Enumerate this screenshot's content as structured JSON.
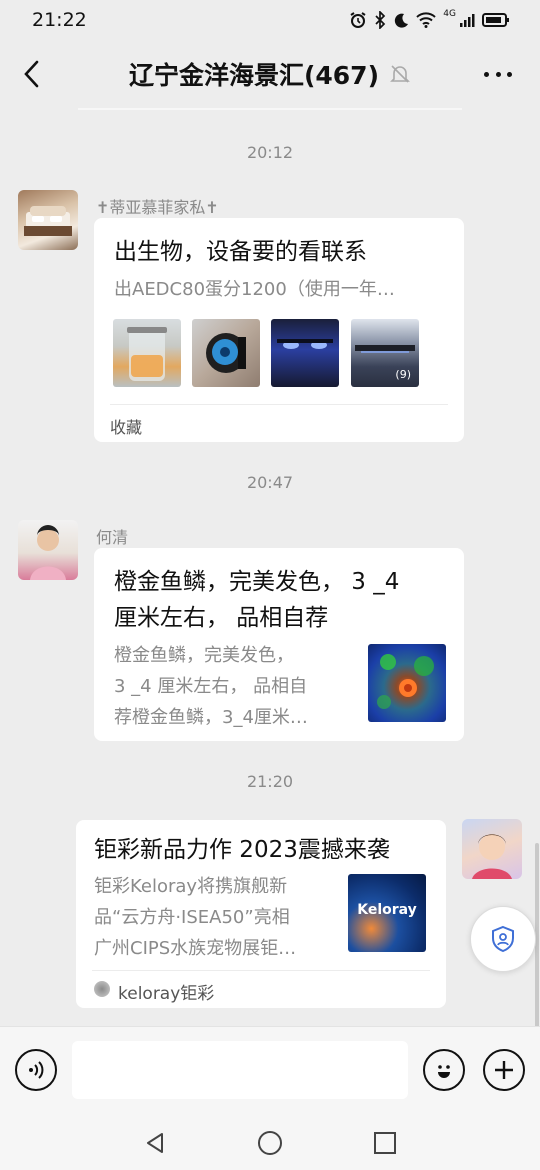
{
  "status_bar": {
    "time": "21:22",
    "network": "4G"
  },
  "header": {
    "title": "辽宁金洋海景汇(467)"
  },
  "messages": [
    {
      "timestamp": "20:12",
      "sender": "✝蒂亚慕菲家私✝",
      "title": "出生物，设备要的看联系",
      "desc": "出AEDC80蛋分1200（使用一年…",
      "image_count": "(9)",
      "footer": "收藏"
    },
    {
      "timestamp": "20:47",
      "sender": "何清",
      "title_line1": "橙金鱼鳞，完美发色， 3 _4",
      "title_line2": "厘米左右， 品相自荐",
      "desc_line1": "橙金鱼鳞，完美发色，",
      "desc_line2": "3 _4 厘米左右， 品相自",
      "desc_line3": "荐橙金鱼鳞，3_4厘米…"
    },
    {
      "timestamp": "21:20",
      "title": "钜彩新品力作 2023震撼来袭",
      "desc_line1": "钜彩Keloray将携旗舰新",
      "desc_line2": "品“云方舟·ISEA50”亮相",
      "desc_line3": "广州CIPS水族宠物展钜…",
      "thumb_text": "Keloray",
      "source": "keloray钜彩"
    }
  ],
  "colors": {
    "background": "#ededed",
    "card": "#ffffff",
    "timestamp": "#8a8a8a",
    "accent_blue": "#3f6fd6"
  }
}
